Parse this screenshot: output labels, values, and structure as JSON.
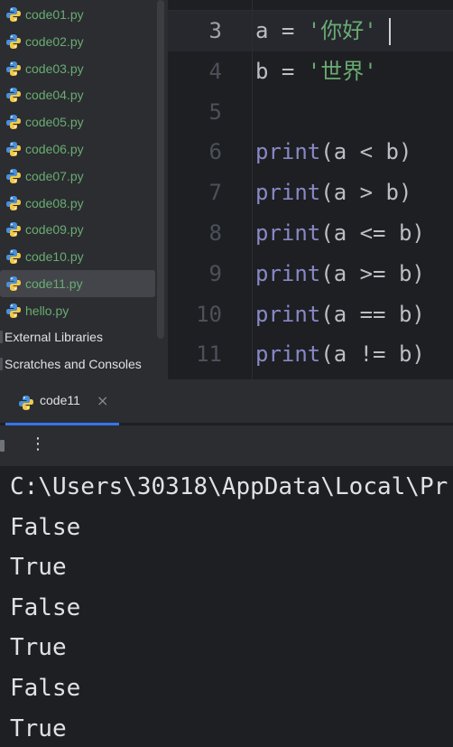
{
  "project_tree": {
    "files": [
      {
        "name": "code01.py",
        "icon": "python-file-icon"
      },
      {
        "name": "code02.py",
        "icon": "python-file-icon"
      },
      {
        "name": "code03.py",
        "icon": "python-file-icon"
      },
      {
        "name": "code04.py",
        "icon": "python-file-icon"
      },
      {
        "name": "code05.py",
        "icon": "python-file-icon"
      },
      {
        "name": "code06.py",
        "icon": "python-file-icon"
      },
      {
        "name": "code07.py",
        "icon": "python-file-icon"
      },
      {
        "name": "code08.py",
        "icon": "python-file-icon"
      },
      {
        "name": "code09.py",
        "icon": "python-file-icon"
      },
      {
        "name": "code10.py",
        "icon": "python-file-icon"
      },
      {
        "name": "code11.py",
        "icon": "python-file-icon",
        "selected": true
      },
      {
        "name": "hello.py",
        "icon": "python-file-icon"
      }
    ],
    "folders": [
      {
        "name": "External Libraries"
      },
      {
        "name": "Scratches and Consoles"
      }
    ]
  },
  "editor": {
    "lines": [
      {
        "num": "3",
        "text": "a = '你好'",
        "active": true
      },
      {
        "num": "4",
        "text": "b = '世界'"
      },
      {
        "num": "5",
        "text": ""
      },
      {
        "num": "6",
        "text": "print(a < b)"
      },
      {
        "num": "7",
        "text": "print(a > b)"
      },
      {
        "num": "8",
        "text": "print(a <= b)"
      },
      {
        "num": "9",
        "text": "print(a >= b)"
      },
      {
        "num": "10",
        "text": "print(a == b)"
      },
      {
        "num": "11",
        "text": "print(a != b)"
      }
    ]
  },
  "run_window": {
    "tab_label": "code11",
    "close_glyph": "×",
    "more_glyph": "⋮",
    "output": [
      "C:\\Users\\30318\\AppData\\Local\\Pr",
      "False",
      "True",
      "False",
      "True",
      "False",
      "True"
    ]
  },
  "colors": {
    "background": "#1e1f22",
    "panel": "#2b2d30",
    "file_name_green": "#6aab73",
    "builtin_purple": "#8888c6",
    "string_green": "#6aab73",
    "tab_accent": "#3574f0"
  }
}
